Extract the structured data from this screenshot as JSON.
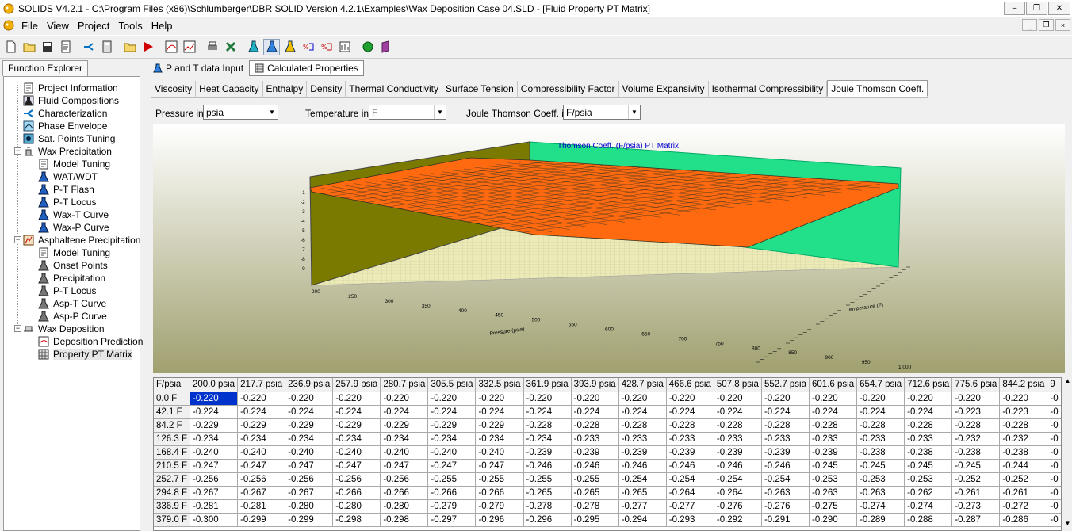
{
  "window": {
    "title": "SOLIDS V4.2.1 - C:\\Program Files (x86)\\Schlumberger\\DBR SOLID Version 4.2.1\\Examples\\Wax Deposition Case 04.SLD - [Fluid Property PT Matrix]",
    "minimize_glyph": "–",
    "maximize_glyph": "❐",
    "close_glyph": "✕"
  },
  "menu": {
    "items": [
      "File",
      "View",
      "Project",
      "Tools",
      "Help"
    ]
  },
  "mdi": {
    "minimize_glyph": "_",
    "restore_glyph": "❐",
    "close_glyph": "×"
  },
  "toolbar": {
    "buttons": [
      "new-file-icon",
      "open-folder-icon",
      "save-icon",
      "report-icon",
      "characterize-icon",
      "calculator-icon",
      "open-project-icon",
      "run-icon",
      "phase-plot-icon",
      "chart-icon",
      "print-icon",
      "excel-icon",
      "fluid-flask-icon",
      "wax-flask-icon",
      "asphaltene-flask-icon",
      "mol-percent-icon",
      "wt-percent-icon",
      "tuning-icon",
      "green-cube-icon",
      "book-icon"
    ]
  },
  "explorer": {
    "tab_label": "Function Explorer",
    "items": [
      {
        "label": "Project Information",
        "icon": "document-icon",
        "level": 0
      },
      {
        "label": "Fluid Compositions",
        "icon": "flask-icon",
        "level": 0
      },
      {
        "label": "Characterization",
        "icon": "arrow-split-icon",
        "level": 0
      },
      {
        "label": "Phase Envelope",
        "icon": "envelope-chart-icon",
        "level": 0
      },
      {
        "label": "Sat. Points Tuning",
        "icon": "tuning-icon",
        "level": 0
      },
      {
        "label": "Wax Precipitation",
        "icon": "wax-icon",
        "level": 0,
        "expanded": true
      },
      {
        "label": "Model Tuning",
        "icon": "document-icon",
        "level": 1
      },
      {
        "label": "WAT/WDT",
        "icon": "blue-flask-icon",
        "level": 1
      },
      {
        "label": "P-T Flash",
        "icon": "blue-flask-icon",
        "level": 1
      },
      {
        "label": "P-T Locus",
        "icon": "blue-flask-icon",
        "level": 1
      },
      {
        "label": "Wax-T Curve",
        "icon": "blue-flask-icon",
        "level": 1
      },
      {
        "label": "Wax-P Curve",
        "icon": "blue-flask-icon",
        "level": 1
      },
      {
        "label": "Asphaltene Precipitation",
        "icon": "asphaltene-icon",
        "level": 0,
        "expanded": true
      },
      {
        "label": "Model Tuning",
        "icon": "document-icon",
        "level": 1
      },
      {
        "label": "Onset Points",
        "icon": "gray-flask-icon",
        "level": 1
      },
      {
        "label": "Precipitation",
        "icon": "gray-flask-icon",
        "level": 1
      },
      {
        "label": "P-T Locus",
        "icon": "gray-flask-icon",
        "level": 1
      },
      {
        "label": "Asp-T Curve",
        "icon": "gray-flask-icon",
        "level": 1
      },
      {
        "label": "Asp-P Curve",
        "icon": "gray-flask-icon",
        "level": 1
      },
      {
        "label": "Wax Deposition",
        "icon": "pipe-icon",
        "level": 0,
        "expanded": true
      },
      {
        "label": "Deposition Prediction",
        "icon": "chart-doc-icon",
        "level": 1
      },
      {
        "label": "Property PT Matrix",
        "icon": "table-icon",
        "level": 1,
        "selected": true
      }
    ]
  },
  "top_tabs": [
    {
      "label": "P and T data Input",
      "icon": "flask-icon",
      "active": false
    },
    {
      "label": "Calculated Properties",
      "icon": "table-icon",
      "active": true
    }
  ],
  "prop_tabs": [
    {
      "label": "Viscosity",
      "active": false
    },
    {
      "label": "Heat Capacity",
      "active": false
    },
    {
      "label": "Enthalpy",
      "active": false
    },
    {
      "label": "Density",
      "active": false
    },
    {
      "label": "Thermal Conductivity",
      "active": false
    },
    {
      "label": "Surface Tension",
      "active": false
    },
    {
      "label": "Compressibility Factor",
      "active": false
    },
    {
      "label": "Volume Expansivity",
      "active": false
    },
    {
      "label": "Isothermal Compressibility",
      "active": false
    },
    {
      "label": "Joule Thomson Coeff.",
      "active": true
    }
  ],
  "units": {
    "pressure_label": "Pressure in",
    "pressure_value": "psia",
    "temperature_label": "Temperature in",
    "temperature_value": "F",
    "jt_label": "Joule Thomson Coeff. in",
    "jt_value": "F/psia"
  },
  "chart_data": {
    "type": "surface",
    "title": "Joule Thomson Coeff. (F/psia) PT Matrix",
    "title_visible": "Thomson Coeff. (F/psia) PT Matrix",
    "xlabel": "Pressure (psia)",
    "ylabel": "Temperature (F)",
    "z_ticks": [
      "-1",
      "-2",
      "-3",
      "-4",
      "-5",
      "-6",
      "-7",
      "-8",
      "-9"
    ],
    "x_ticks": [
      "200",
      "250",
      "300",
      "350",
      "400",
      "450",
      "500",
      "550",
      "600",
      "650",
      "700",
      "750",
      "800",
      "850",
      "900",
      "950",
      "1,000"
    ],
    "colors": {
      "surface": "#ff6a10",
      "back_wall": "#22e08a",
      "left_wall": "#7a7a00",
      "floor": "#e8e8b0",
      "gradient_top": "#ffffff",
      "gradient_bottom": "#a0a070"
    }
  },
  "table": {
    "corner": "F/psia",
    "columns": [
      "200.0 psia",
      "217.7 psia",
      "236.9 psia",
      "257.9 psia",
      "280.7 psia",
      "305.5 psia",
      "332.5 psia",
      "361.9 psia",
      "393.9 psia",
      "428.7 psia",
      "466.6 psia",
      "507.8 psia",
      "552.7 psia",
      "601.6 psia",
      "654.7 psia",
      "712.6 psia",
      "775.6 psia",
      "844.2 psia",
      "9"
    ],
    "rows": [
      {
        "label": "0.0 F",
        "values": [
          "-0.220",
          "-0.220",
          "-0.220",
          "-0.220",
          "-0.220",
          "-0.220",
          "-0.220",
          "-0.220",
          "-0.220",
          "-0.220",
          "-0.220",
          "-0.220",
          "-0.220",
          "-0.220",
          "-0.220",
          "-0.220",
          "-0.220",
          "-0.220",
          "-0"
        ]
      },
      {
        "label": "42.1 F",
        "values": [
          "-0.224",
          "-0.224",
          "-0.224",
          "-0.224",
          "-0.224",
          "-0.224",
          "-0.224",
          "-0.224",
          "-0.224",
          "-0.224",
          "-0.224",
          "-0.224",
          "-0.224",
          "-0.224",
          "-0.224",
          "-0.224",
          "-0.223",
          "-0.223",
          "-0"
        ]
      },
      {
        "label": "84.2 F",
        "values": [
          "-0.229",
          "-0.229",
          "-0.229",
          "-0.229",
          "-0.229",
          "-0.229",
          "-0.229",
          "-0.228",
          "-0.228",
          "-0.228",
          "-0.228",
          "-0.228",
          "-0.228",
          "-0.228",
          "-0.228",
          "-0.228",
          "-0.228",
          "-0.228",
          "-0"
        ]
      },
      {
        "label": "126.3 F",
        "values": [
          "-0.234",
          "-0.234",
          "-0.234",
          "-0.234",
          "-0.234",
          "-0.234",
          "-0.234",
          "-0.234",
          "-0.233",
          "-0.233",
          "-0.233",
          "-0.233",
          "-0.233",
          "-0.233",
          "-0.233",
          "-0.233",
          "-0.232",
          "-0.232",
          "-0"
        ]
      },
      {
        "label": "168.4 F",
        "values": [
          "-0.240",
          "-0.240",
          "-0.240",
          "-0.240",
          "-0.240",
          "-0.240",
          "-0.240",
          "-0.239",
          "-0.239",
          "-0.239",
          "-0.239",
          "-0.239",
          "-0.239",
          "-0.239",
          "-0.238",
          "-0.238",
          "-0.238",
          "-0.238",
          "-0"
        ]
      },
      {
        "label": "210.5 F",
        "values": [
          "-0.247",
          "-0.247",
          "-0.247",
          "-0.247",
          "-0.247",
          "-0.247",
          "-0.247",
          "-0.246",
          "-0.246",
          "-0.246",
          "-0.246",
          "-0.246",
          "-0.246",
          "-0.245",
          "-0.245",
          "-0.245",
          "-0.245",
          "-0.244",
          "-0"
        ]
      },
      {
        "label": "252.7 F",
        "values": [
          "-0.256",
          "-0.256",
          "-0.256",
          "-0.256",
          "-0.256",
          "-0.255",
          "-0.255",
          "-0.255",
          "-0.255",
          "-0.254",
          "-0.254",
          "-0.254",
          "-0.254",
          "-0.253",
          "-0.253",
          "-0.253",
          "-0.252",
          "-0.252",
          "-0"
        ]
      },
      {
        "label": "294.8 F",
        "values": [
          "-0.267",
          "-0.267",
          "-0.267",
          "-0.266",
          "-0.266",
          "-0.266",
          "-0.266",
          "-0.265",
          "-0.265",
          "-0.265",
          "-0.264",
          "-0.264",
          "-0.263",
          "-0.263",
          "-0.263",
          "-0.262",
          "-0.261",
          "-0.261",
          "-0"
        ]
      },
      {
        "label": "336.9 F",
        "values": [
          "-0.281",
          "-0.281",
          "-0.280",
          "-0.280",
          "-0.280",
          "-0.279",
          "-0.279",
          "-0.278",
          "-0.278",
          "-0.277",
          "-0.277",
          "-0.276",
          "-0.276",
          "-0.275",
          "-0.274",
          "-0.274",
          "-0.273",
          "-0.272",
          "-0"
        ]
      },
      {
        "label": "379.0 F",
        "values": [
          "-0.300",
          "-0.299",
          "-0.299",
          "-0.298",
          "-0.298",
          "-0.297",
          "-0.296",
          "-0.296",
          "-0.295",
          "-0.294",
          "-0.293",
          "-0.292",
          "-0.291",
          "-0.290",
          "-0.289",
          "-0.288",
          "-0.287",
          "-0.286",
          "-0"
        ]
      }
    ]
  },
  "scroll": {
    "up_glyph": "▲",
    "down_glyph": "▼"
  }
}
